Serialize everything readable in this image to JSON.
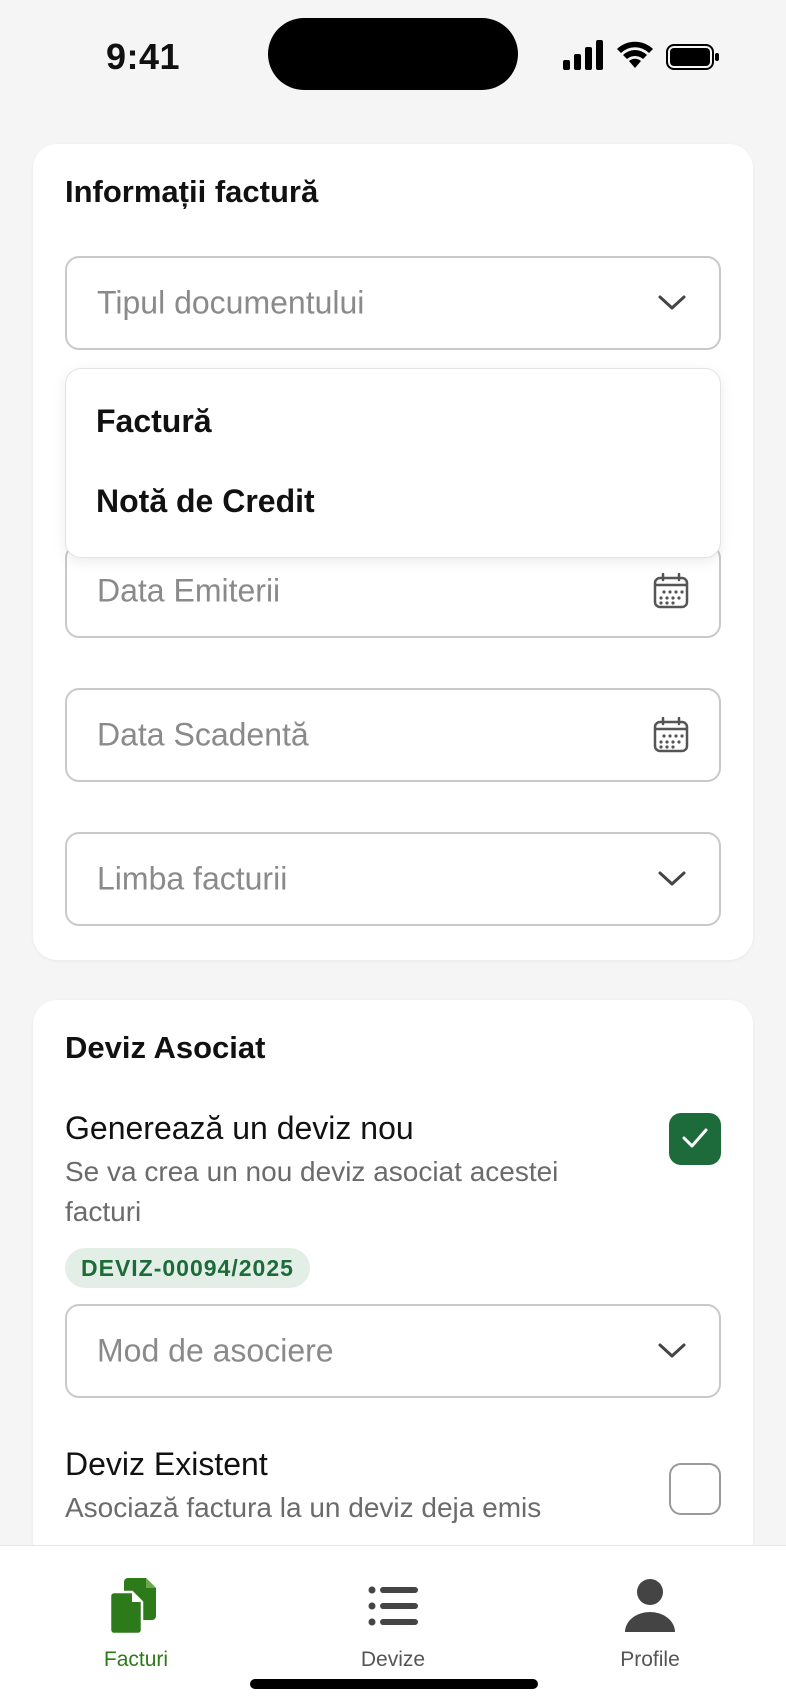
{
  "status_bar": {
    "time": "9:41"
  },
  "invoice_card": {
    "title": "Informații factură",
    "document_type": {
      "placeholder": "Tipul documentului"
    },
    "dropdown_options": [
      "Factură",
      "Notă de Credit"
    ],
    "issue_date": {
      "placeholder": "Data Emiterii"
    },
    "due_date": {
      "placeholder": "Data Scadentă"
    },
    "invoice_language": {
      "placeholder": "Limba facturii"
    }
  },
  "estimate_card": {
    "title": "Deviz Asociat",
    "new_estimate": {
      "title": "Generează un deviz nou",
      "subtitle": "Se va crea un nou deviz asociat acestei facturi",
      "checked": true,
      "tag": "DEVIZ-00094/2025"
    },
    "association_mode": {
      "placeholder": "Mod de asociere"
    },
    "existing_estimate": {
      "title": "Deviz Existent",
      "subtitle": "Asociază factura la un deviz deja emis",
      "checked": false
    }
  },
  "bottom_nav": {
    "items": [
      {
        "label": "Facturi",
        "icon": "documents-icon",
        "active": true
      },
      {
        "label": "Devize",
        "icon": "list-icon",
        "active": false
      },
      {
        "label": "Profile",
        "icon": "person-icon",
        "active": false
      }
    ]
  },
  "colors": {
    "accent": "#1d6b3a",
    "nav_active": "#2d7a1a",
    "tag_bg": "#e3efe6"
  }
}
